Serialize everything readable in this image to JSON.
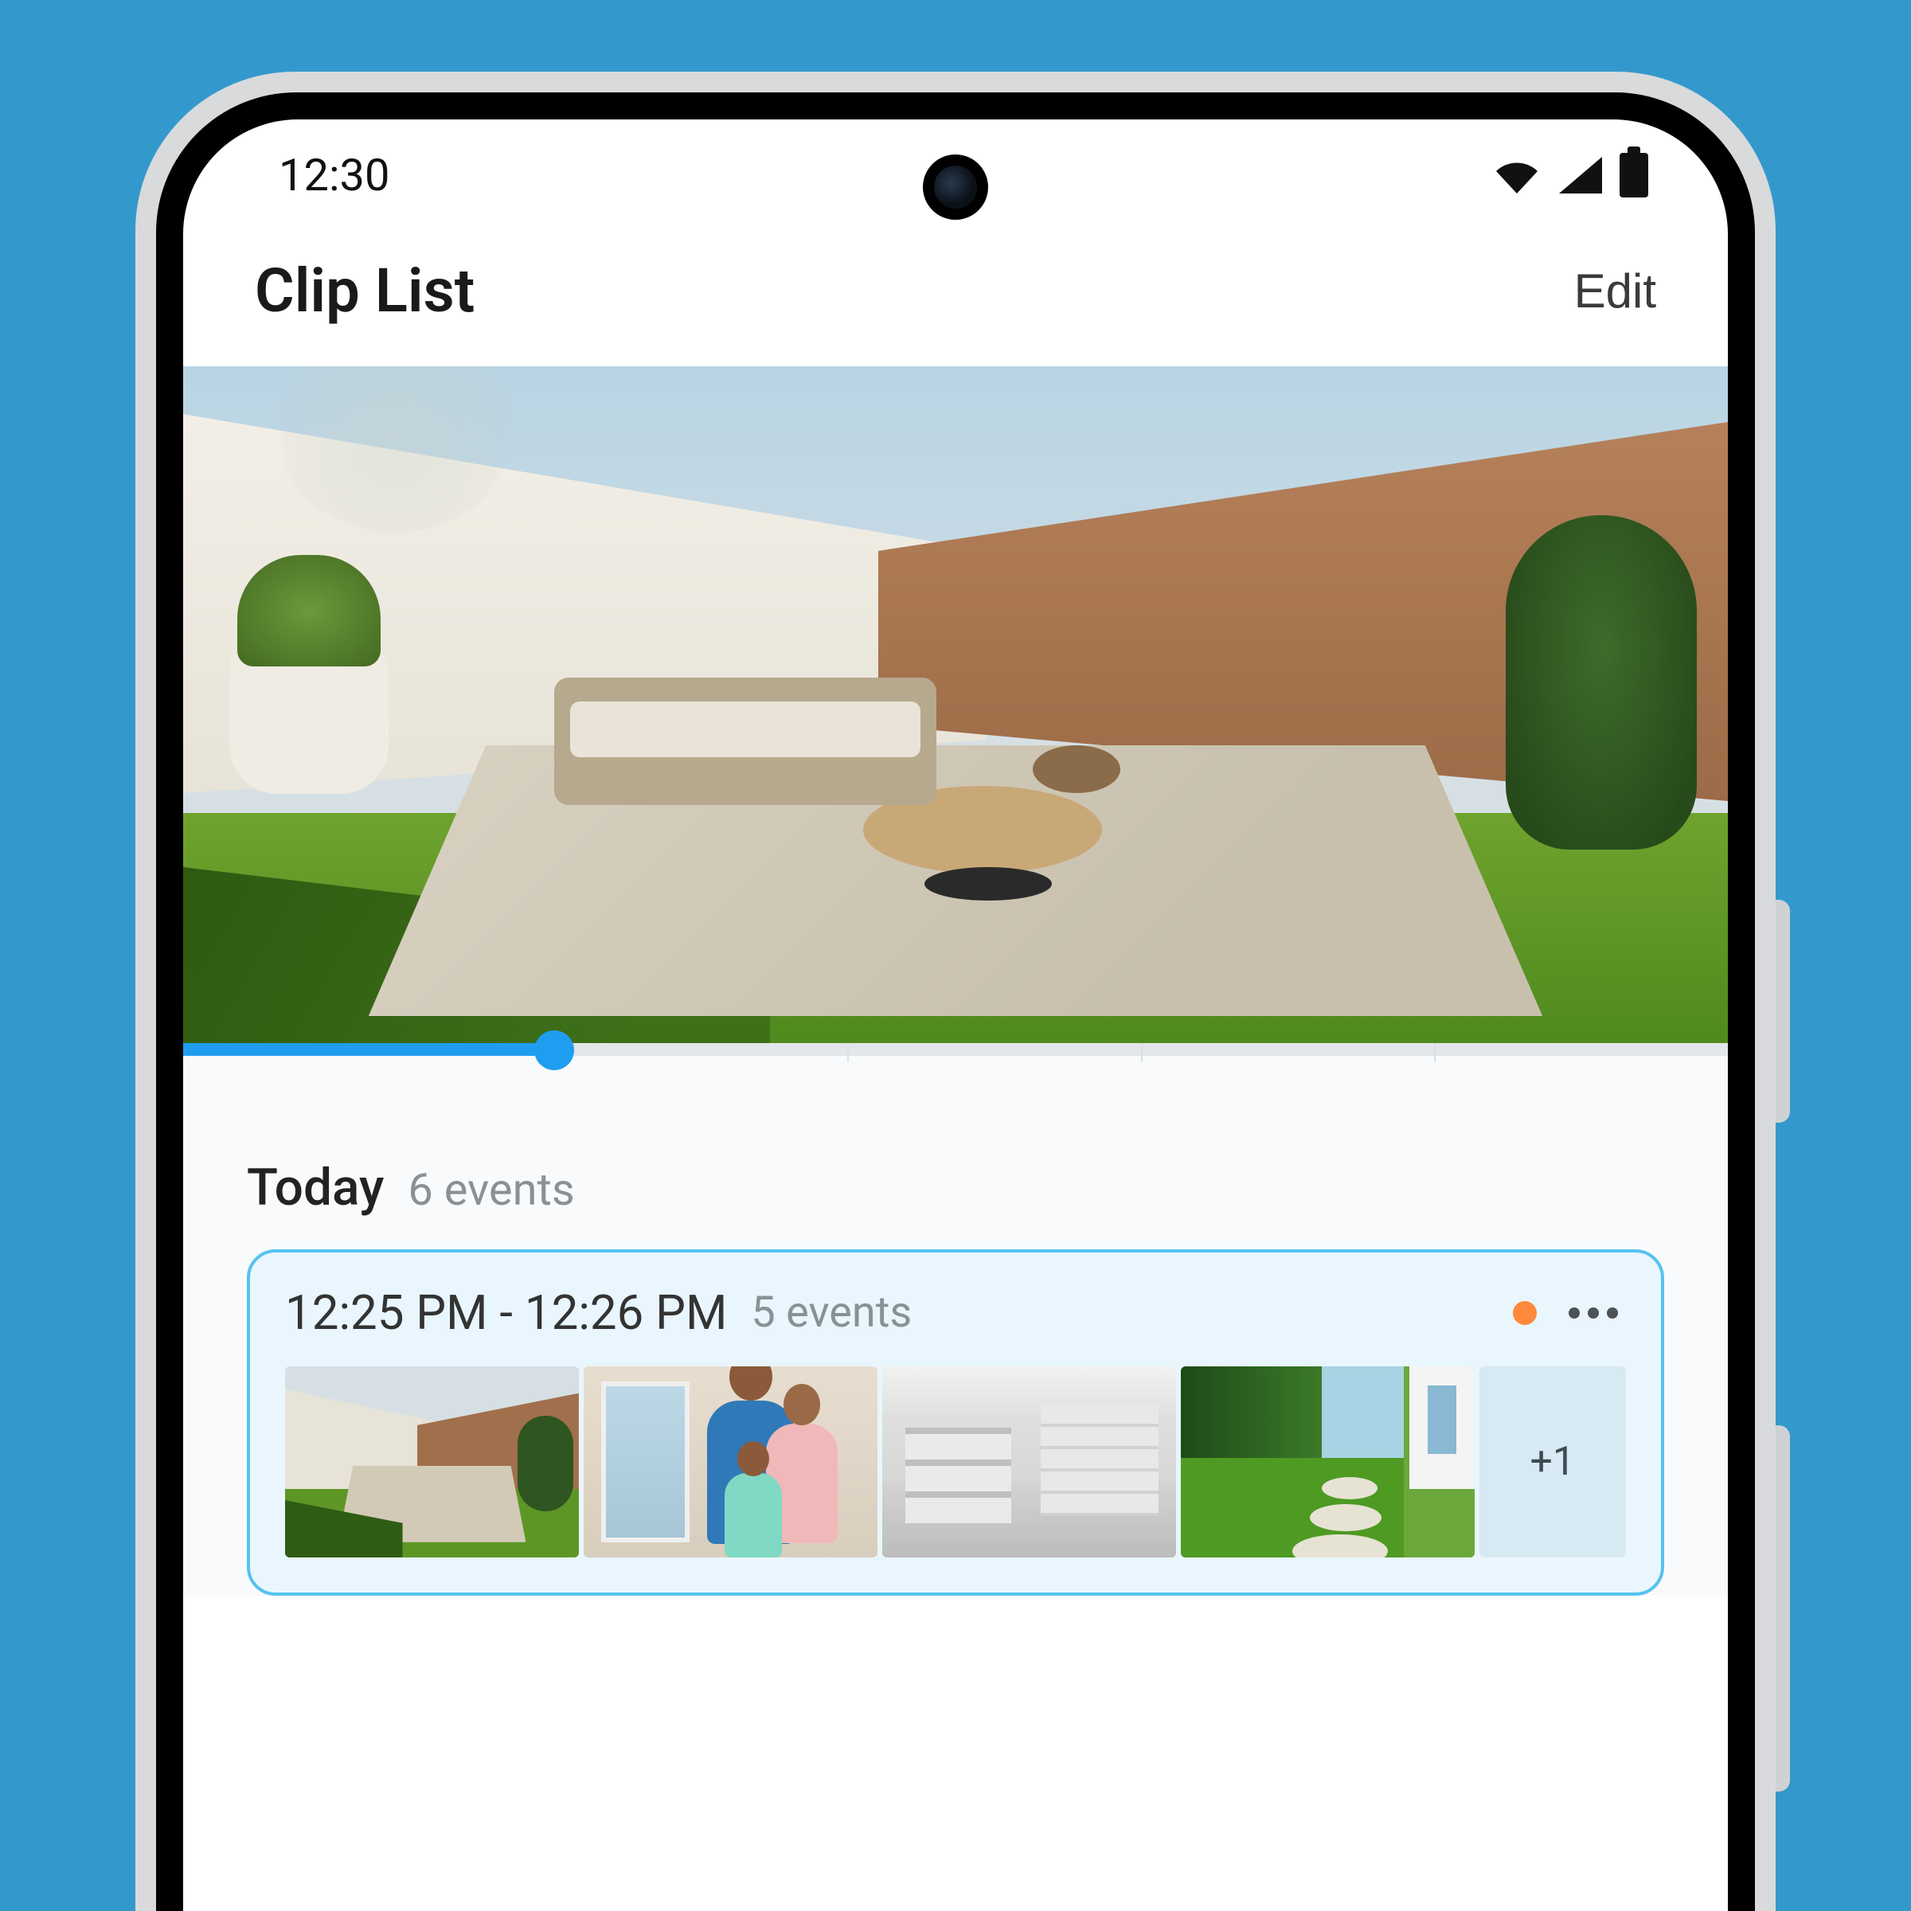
{
  "status": {
    "time": "12:30",
    "icons": {
      "wifi": "wifi-icon",
      "cell": "cellular-icon",
      "battery": "battery-icon"
    }
  },
  "header": {
    "title": "Clip List",
    "edit_label": "Edit"
  },
  "scrubber": {
    "progress_pct": 24,
    "ticks_pct": [
      43,
      62,
      81
    ]
  },
  "section": {
    "title": "Today",
    "sub": "6 events"
  },
  "event_card": {
    "time_range": "12:25 PM - 12:26 PM",
    "count_label": "5 events",
    "badge": "unread",
    "more_label": "+1",
    "thumbs": [
      {
        "name": "backyard"
      },
      {
        "name": "family"
      },
      {
        "name": "garage"
      },
      {
        "name": "garden-path"
      }
    ]
  },
  "colors": {
    "accent": "#1f9df0",
    "card_bg": "#e9f6fd",
    "card_border": "#56c2ef",
    "bg": "#3399cc"
  }
}
